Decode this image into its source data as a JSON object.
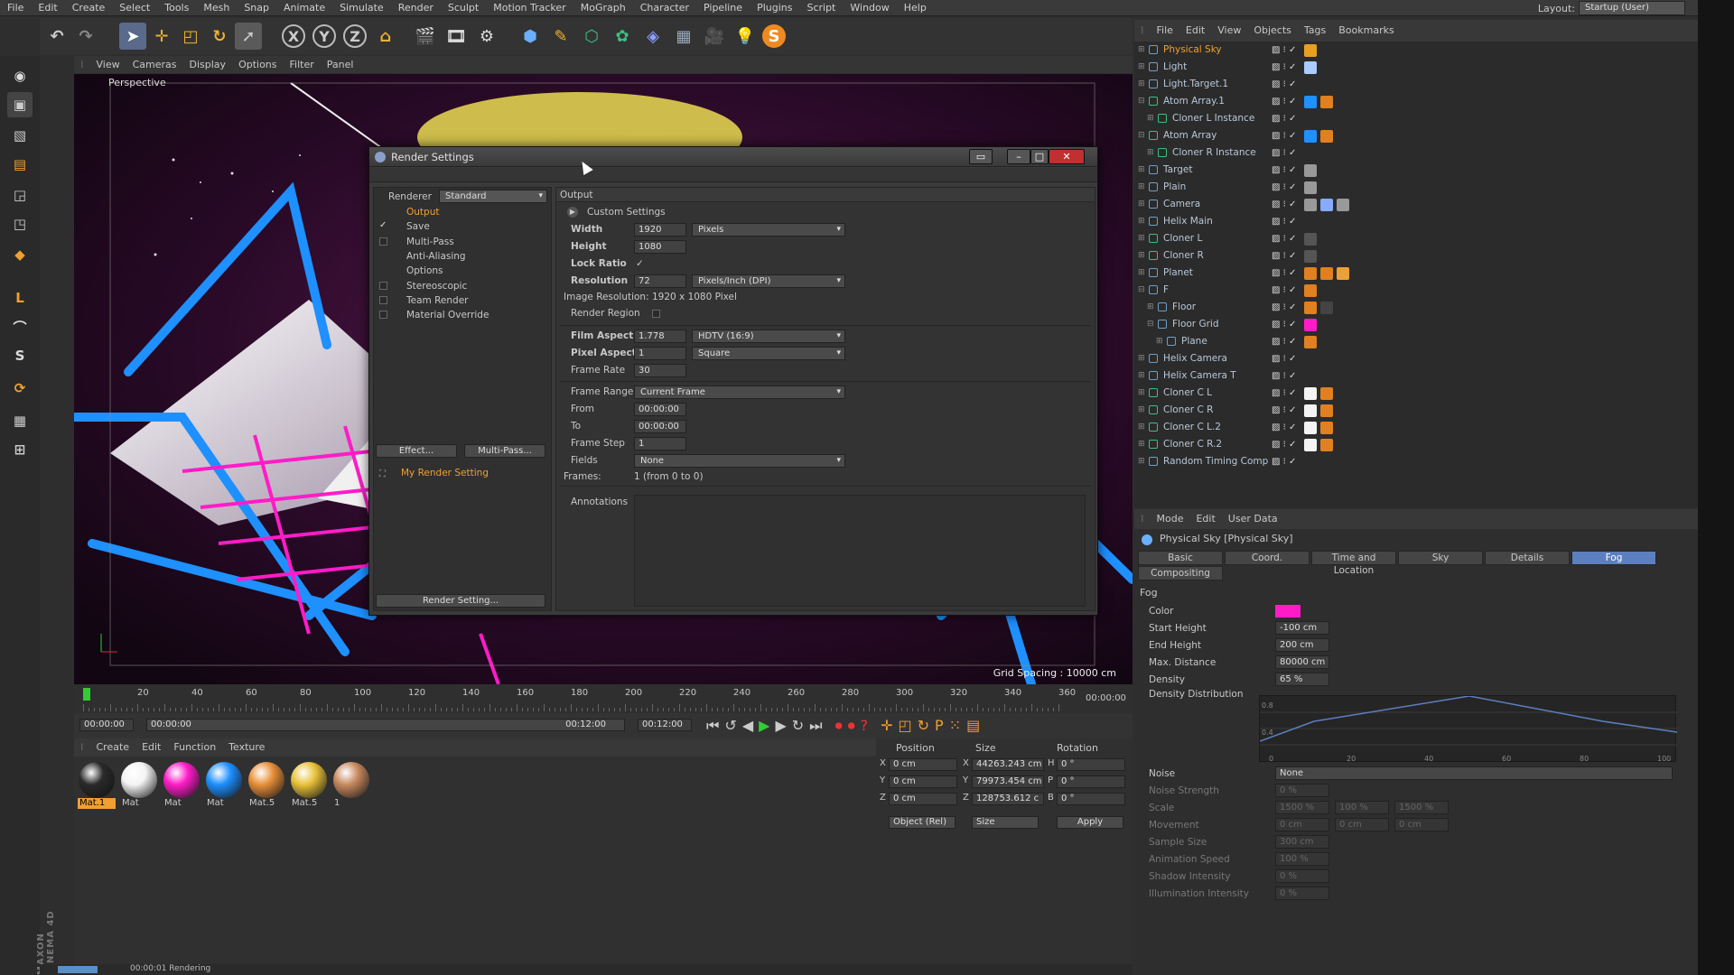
{
  "menu": [
    "File",
    "Edit",
    "Create",
    "Select",
    "Tools",
    "Mesh",
    "Snap",
    "Animate",
    "Simulate",
    "Render",
    "Sculpt",
    "Motion Tracker",
    "MoGraph",
    "Character",
    "Pipeline",
    "Plugins",
    "Script",
    "Window",
    "Help"
  ],
  "layout": {
    "label": "Layout:",
    "value": "Startup (User)"
  },
  "brand": "MAXON CINEMA 4D",
  "viewport": {
    "menu": [
      "View",
      "Cameras",
      "Display",
      "Options",
      "Filter",
      "Panel"
    ],
    "label": "Perspective",
    "grid_spacing": "Grid Spacing : 10000 cm"
  },
  "timeline": {
    "ticks": [
      "0",
      "20",
      "40",
      "60",
      "80",
      "100",
      "120",
      "140",
      "160",
      "180",
      "200",
      "220",
      "240",
      "260",
      "280",
      "300",
      "320",
      "340",
      "360"
    ],
    "end_time": "00:00:00",
    "start": "00:00:00",
    "range_start": "00:00:00",
    "range_end": "00:12:00",
    "end": "00:12:00"
  },
  "materials": {
    "menu": [
      "Create",
      "Edit",
      "Function",
      "Texture"
    ],
    "items": [
      {
        "label": "Mat.1",
        "color": "#2a2a2a"
      },
      {
        "label": "Mat",
        "color": "#f4f4f4"
      },
      {
        "label": "Mat",
        "color": "#ff1cc8"
      },
      {
        "label": "Mat",
        "color": "#1e90ff"
      },
      {
        "label": "Mat.5",
        "color": "#e8903a"
      },
      {
        "label": "Mat.5",
        "color": "#e9c23a"
      },
      {
        "label": "1",
        "color": "#c88a60"
      }
    ]
  },
  "coords": {
    "headers": [
      "Position",
      "Size",
      "Rotation"
    ],
    "rows": [
      {
        "axis": "X",
        "pos": "0 cm",
        "size_axis": "X",
        "size": "44263.243 cm",
        "rot_axis": "H",
        "rot": "0 °"
      },
      {
        "axis": "Y",
        "pos": "0 cm",
        "size_axis": "Y",
        "size": "79973.454 cm",
        "rot_axis": "P",
        "rot": "0 °"
      },
      {
        "axis": "Z",
        "pos": "0 cm",
        "size_axis": "Z",
        "size": "128753.612 c",
        "rot_axis": "B",
        "rot": "0 °"
      }
    ],
    "mode": "Object (Rel)",
    "size_mode": "Size",
    "apply": "Apply"
  },
  "status": "00:00:01 Rendering",
  "objects": {
    "menu": [
      "File",
      "Edit",
      "View",
      "Objects",
      "Tags",
      "Bookmarks"
    ],
    "items": [
      {
        "name": "Physical Sky",
        "indent": 0,
        "selected": true,
        "tags": [
          "#e8a020"
        ]
      },
      {
        "name": "Light",
        "indent": 0,
        "tags": [
          "#aaccff"
        ]
      },
      {
        "name": "Light.Target.1",
        "indent": 0,
        "tags": []
      },
      {
        "name": "Atom Array.1",
        "indent": 0,
        "tags": [
          "#1e90ff",
          "#e08020"
        ]
      },
      {
        "name": "Cloner L Instance",
        "indent": 1,
        "tags": []
      },
      {
        "name": "Atom Array",
        "indent": 0,
        "tags": [
          "#1e90ff",
          "#e08020"
        ]
      },
      {
        "name": "Cloner R Instance",
        "indent": 1,
        "tags": []
      },
      {
        "name": "Target",
        "indent": 0,
        "tags": [
          "#999"
        ]
      },
      {
        "name": "Plain",
        "indent": 0,
        "tags": [
          "#999"
        ]
      },
      {
        "name": "Camera",
        "indent": 0,
        "tags": [
          "#999",
          "#88aaff",
          "#999"
        ]
      },
      {
        "name": "Helix Main",
        "indent": 0,
        "tags": []
      },
      {
        "name": "Cloner L",
        "indent": 0,
        "tags": [
          "#555"
        ]
      },
      {
        "name": "Cloner R",
        "indent": 0,
        "tags": [
          "#555"
        ]
      },
      {
        "name": "Planet",
        "indent": 0,
        "tags": [
          "#e08020",
          "#e08020",
          "#e9a13a"
        ]
      },
      {
        "name": "F",
        "indent": 0,
        "tags": [
          "#e08020"
        ]
      },
      {
        "name": "Floor",
        "indent": 1,
        "tags": [
          "#e08020",
          "#444"
        ]
      },
      {
        "name": "Floor Grid",
        "indent": 1,
        "tags": [
          "#ff1cc8"
        ]
      },
      {
        "name": "Plane",
        "indent": 2,
        "tags": [
          "#e08020"
        ]
      },
      {
        "name": "Helix Camera",
        "indent": 0,
        "tags": []
      },
      {
        "name": "Helix Camera T",
        "indent": 0,
        "tags": []
      },
      {
        "name": "Cloner C L",
        "indent": 0,
        "tags": [
          "#f4f4f4",
          "#e08020"
        ]
      },
      {
        "name": "Cloner C R",
        "indent": 0,
        "tags": [
          "#f4f4f4",
          "#e08020"
        ]
      },
      {
        "name": "Cloner C L.2",
        "indent": 0,
        "tags": [
          "#f4f4f4",
          "#e08020"
        ]
      },
      {
        "name": "Cloner C R.2",
        "indent": 0,
        "tags": [
          "#f4f4f4",
          "#e08020"
        ]
      },
      {
        "name": "Random Timing Comp",
        "indent": 0,
        "tags": []
      }
    ]
  },
  "attributes": {
    "menu": [
      "Mode",
      "Edit",
      "User Data"
    ],
    "title": "Physical Sky [Physical Sky]",
    "tabs": [
      "Basic",
      "Coord.",
      "Time and Location",
      "Sky",
      "Details",
      "Fog",
      "Compositing"
    ],
    "active_tab": "Fog",
    "section": "Fog",
    "color_label": "Color",
    "color_value": "#ff1cc8",
    "fields": [
      {
        "label": "Start Height",
        "value": "-100 cm"
      },
      {
        "label": "End Height",
        "value": "200 cm"
      },
      {
        "label": "Max. Distance",
        "value": "80000 cm"
      },
      {
        "label": "Density",
        "value": "65 %"
      }
    ],
    "density_distribution": "Density Distribution",
    "graph_ticks": [
      "0",
      "20",
      "40",
      "60",
      "80",
      "100"
    ],
    "graph_y": [
      "0.8",
      "0.4"
    ],
    "noise": {
      "label": "Noise",
      "value": "None"
    },
    "dim_fields": [
      {
        "label": "Noise Strength",
        "value": "0 %"
      },
      {
        "label": "Scale",
        "value": "1500 %",
        "v2": "100 %",
        "v3": "1500 %"
      },
      {
        "label": "Movement",
        "value": "0 cm",
        "v2": "0 cm",
        "v3": "0 cm"
      },
      {
        "label": "Sample Size",
        "value": "300 cm"
      },
      {
        "label": "Animation Speed",
        "value": "100 %"
      },
      {
        "label": "Shadow Intensity",
        "value": "0 %"
      },
      {
        "label": "Illumination Intensity",
        "value": "0 %"
      }
    ]
  },
  "render_dialog": {
    "title": "Render Settings",
    "renderer_label": "Renderer",
    "renderer": "Standard",
    "nav": [
      {
        "label": "Output",
        "active": true,
        "check": false
      },
      {
        "label": "Save",
        "check": true
      },
      {
        "label": "Multi-Pass",
        "check": false,
        "box": true
      },
      {
        "label": "Anti-Aliasing"
      },
      {
        "label": "Options"
      },
      {
        "label": "Stereoscopic",
        "box": true
      },
      {
        "label": "Team Render",
        "box": true
      },
      {
        "label": "Material Override",
        "box": true
      }
    ],
    "effect_btn": "Effect...",
    "multipass_btn": "Multi-Pass...",
    "setting_name": "My Render Setting",
    "render_setting_btn": "Render Setting...",
    "section": "Output",
    "custom": "Custom Settings",
    "width": {
      "label": "Width",
      "value": "1920",
      "unit": "Pixels"
    },
    "height": {
      "label": "Height",
      "value": "1080"
    },
    "lock_ratio": {
      "label": "Lock Ratio",
      "value": "✓"
    },
    "resolution": {
      "label": "Resolution",
      "value": "72",
      "unit": "Pixels/Inch (DPI)"
    },
    "image_res": "Image Resolution: 1920 x 1080 Pixel",
    "render_region": "Render Region",
    "film_aspect": {
      "label": "Film Aspect",
      "value": "1.778",
      "preset": "HDTV (16:9)"
    },
    "pixel_aspect": {
      "label": "Pixel Aspect",
      "value": "1",
      "preset": "Square"
    },
    "frame_rate": {
      "label": "Frame Rate",
      "value": "30"
    },
    "frame_range": {
      "label": "Frame Range",
      "value": "Current Frame"
    },
    "from": {
      "label": "From",
      "value": "00:00:00"
    },
    "to": {
      "label": "To",
      "value": "00:00:00"
    },
    "frame_step": {
      "label": "Frame Step",
      "value": "1"
    },
    "fields": {
      "label": "Fields",
      "value": "None"
    },
    "frames": {
      "label": "Frames:",
      "value": "1 (from 0 to 0)"
    },
    "annotations": "Annotations"
  }
}
